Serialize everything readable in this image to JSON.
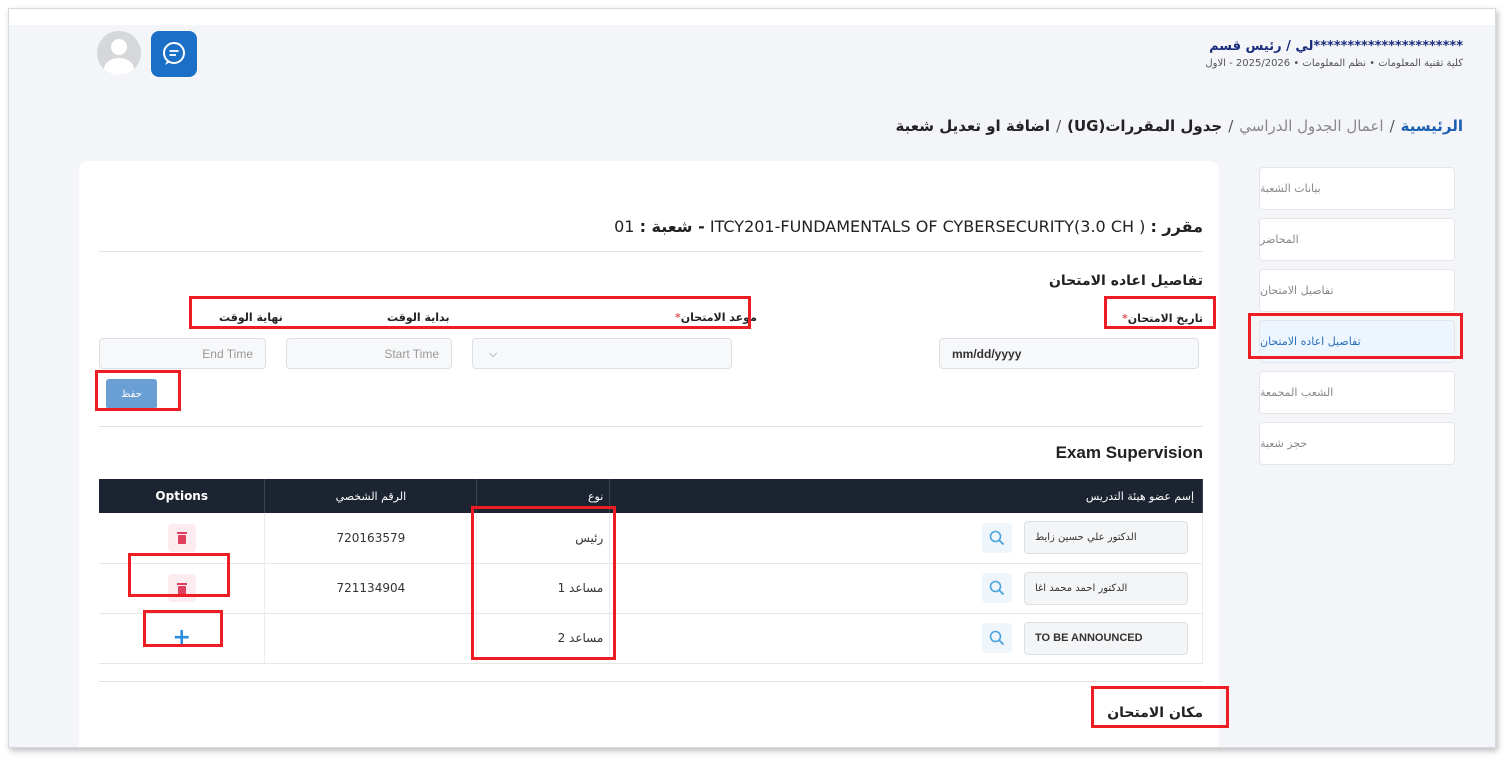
{
  "header": {
    "user_name": "**********************لي / رئيس قسم",
    "user_sub": "كلية تقنية المعلومات  •  نظم المعلومات  •  2025/2026 - الاول"
  },
  "breadcrumb": {
    "home": "الرئيسية",
    "item1": "اعمال الجدول الدراسي",
    "item2": "جدول المقررات(UG)",
    "item3": "اضافة او تعديل شعبة",
    "sep": "/"
  },
  "side_menu": [
    {
      "label": "بيانات الشعبة",
      "active": false
    },
    {
      "label": "المحاضر",
      "active": false
    },
    {
      "label": "تفاصيل الامتحان",
      "active": false
    },
    {
      "label": "تفاصيل اعاده الامتحان",
      "active": true
    },
    {
      "label": "الشعب المجمعة",
      "active": false
    },
    {
      "label": "حجز شعبة",
      "active": false
    }
  ],
  "course": {
    "label": "مقرر :",
    "value": "( ITCY201-FUNDAMENTALS OF CYBERSECURITY(3.0 CH",
    "section_label": "- شعبة :",
    "section_value": "01"
  },
  "reexam": {
    "title": "تفاصيل اعاده الامتحان",
    "date_label": "تاريخ الامتحان",
    "slot_label": "موعد الامتحان",
    "start_label": "بداية الوقت",
    "end_label": "نهاية الوقت",
    "required_mark": "*",
    "date_value": "mm/dd/yyyy",
    "start_placeholder": "Start Time",
    "end_placeholder": "End Time",
    "save_label": "حفظ"
  },
  "supervision": {
    "title": "Exam Supervision",
    "columns": [
      "إسم عضو هيئة التدريس",
      "نوع",
      "الرقم الشخصي",
      "Options"
    ],
    "rows": [
      {
        "name": "الدكتور علي حسين زايط",
        "type": "رئيس",
        "id": "720163579",
        "option": "delete"
      },
      {
        "name": "الدكتور احمد محمد اغا",
        "type": "مساعد 1",
        "id": "721134904",
        "option": "delete"
      },
      {
        "name": "TO BE ANNOUNCED",
        "type": "مساعد 2",
        "id": "",
        "option": "add"
      }
    ]
  },
  "exam_place": {
    "title": "مكان الامتحان"
  },
  "colors": {
    "brand_blue": "#1c6fc7",
    "table_header": "#1d2431",
    "annotation_red": "#ee1d23",
    "delete_red": "#e0405e"
  }
}
